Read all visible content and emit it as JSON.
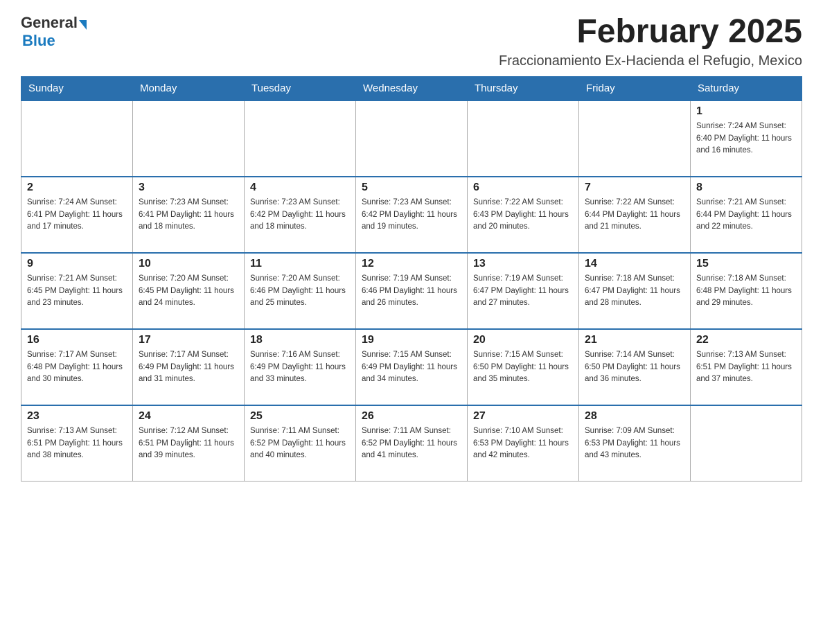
{
  "logo": {
    "general": "General",
    "blue": "Blue"
  },
  "header": {
    "title": "February 2025",
    "subtitle": "Fraccionamiento Ex-Hacienda el Refugio, Mexico"
  },
  "weekdays": [
    "Sunday",
    "Monday",
    "Tuesday",
    "Wednesday",
    "Thursday",
    "Friday",
    "Saturday"
  ],
  "weeks": [
    [
      {
        "day": "",
        "info": ""
      },
      {
        "day": "",
        "info": ""
      },
      {
        "day": "",
        "info": ""
      },
      {
        "day": "",
        "info": ""
      },
      {
        "day": "",
        "info": ""
      },
      {
        "day": "",
        "info": ""
      },
      {
        "day": "1",
        "info": "Sunrise: 7:24 AM\nSunset: 6:40 PM\nDaylight: 11 hours\nand 16 minutes."
      }
    ],
    [
      {
        "day": "2",
        "info": "Sunrise: 7:24 AM\nSunset: 6:41 PM\nDaylight: 11 hours\nand 17 minutes."
      },
      {
        "day": "3",
        "info": "Sunrise: 7:23 AM\nSunset: 6:41 PM\nDaylight: 11 hours\nand 18 minutes."
      },
      {
        "day": "4",
        "info": "Sunrise: 7:23 AM\nSunset: 6:42 PM\nDaylight: 11 hours\nand 18 minutes."
      },
      {
        "day": "5",
        "info": "Sunrise: 7:23 AM\nSunset: 6:42 PM\nDaylight: 11 hours\nand 19 minutes."
      },
      {
        "day": "6",
        "info": "Sunrise: 7:22 AM\nSunset: 6:43 PM\nDaylight: 11 hours\nand 20 minutes."
      },
      {
        "day": "7",
        "info": "Sunrise: 7:22 AM\nSunset: 6:44 PM\nDaylight: 11 hours\nand 21 minutes."
      },
      {
        "day": "8",
        "info": "Sunrise: 7:21 AM\nSunset: 6:44 PM\nDaylight: 11 hours\nand 22 minutes."
      }
    ],
    [
      {
        "day": "9",
        "info": "Sunrise: 7:21 AM\nSunset: 6:45 PM\nDaylight: 11 hours\nand 23 minutes."
      },
      {
        "day": "10",
        "info": "Sunrise: 7:20 AM\nSunset: 6:45 PM\nDaylight: 11 hours\nand 24 minutes."
      },
      {
        "day": "11",
        "info": "Sunrise: 7:20 AM\nSunset: 6:46 PM\nDaylight: 11 hours\nand 25 minutes."
      },
      {
        "day": "12",
        "info": "Sunrise: 7:19 AM\nSunset: 6:46 PM\nDaylight: 11 hours\nand 26 minutes."
      },
      {
        "day": "13",
        "info": "Sunrise: 7:19 AM\nSunset: 6:47 PM\nDaylight: 11 hours\nand 27 minutes."
      },
      {
        "day": "14",
        "info": "Sunrise: 7:18 AM\nSunset: 6:47 PM\nDaylight: 11 hours\nand 28 minutes."
      },
      {
        "day": "15",
        "info": "Sunrise: 7:18 AM\nSunset: 6:48 PM\nDaylight: 11 hours\nand 29 minutes."
      }
    ],
    [
      {
        "day": "16",
        "info": "Sunrise: 7:17 AM\nSunset: 6:48 PM\nDaylight: 11 hours\nand 30 minutes."
      },
      {
        "day": "17",
        "info": "Sunrise: 7:17 AM\nSunset: 6:49 PM\nDaylight: 11 hours\nand 31 minutes."
      },
      {
        "day": "18",
        "info": "Sunrise: 7:16 AM\nSunset: 6:49 PM\nDaylight: 11 hours\nand 33 minutes."
      },
      {
        "day": "19",
        "info": "Sunrise: 7:15 AM\nSunset: 6:49 PM\nDaylight: 11 hours\nand 34 minutes."
      },
      {
        "day": "20",
        "info": "Sunrise: 7:15 AM\nSunset: 6:50 PM\nDaylight: 11 hours\nand 35 minutes."
      },
      {
        "day": "21",
        "info": "Sunrise: 7:14 AM\nSunset: 6:50 PM\nDaylight: 11 hours\nand 36 minutes."
      },
      {
        "day": "22",
        "info": "Sunrise: 7:13 AM\nSunset: 6:51 PM\nDaylight: 11 hours\nand 37 minutes."
      }
    ],
    [
      {
        "day": "23",
        "info": "Sunrise: 7:13 AM\nSunset: 6:51 PM\nDaylight: 11 hours\nand 38 minutes."
      },
      {
        "day": "24",
        "info": "Sunrise: 7:12 AM\nSunset: 6:51 PM\nDaylight: 11 hours\nand 39 minutes."
      },
      {
        "day": "25",
        "info": "Sunrise: 7:11 AM\nSunset: 6:52 PM\nDaylight: 11 hours\nand 40 minutes."
      },
      {
        "day": "26",
        "info": "Sunrise: 7:11 AM\nSunset: 6:52 PM\nDaylight: 11 hours\nand 41 minutes."
      },
      {
        "day": "27",
        "info": "Sunrise: 7:10 AM\nSunset: 6:53 PM\nDaylight: 11 hours\nand 42 minutes."
      },
      {
        "day": "28",
        "info": "Sunrise: 7:09 AM\nSunset: 6:53 PM\nDaylight: 11 hours\nand 43 minutes."
      },
      {
        "day": "",
        "info": ""
      }
    ]
  ]
}
